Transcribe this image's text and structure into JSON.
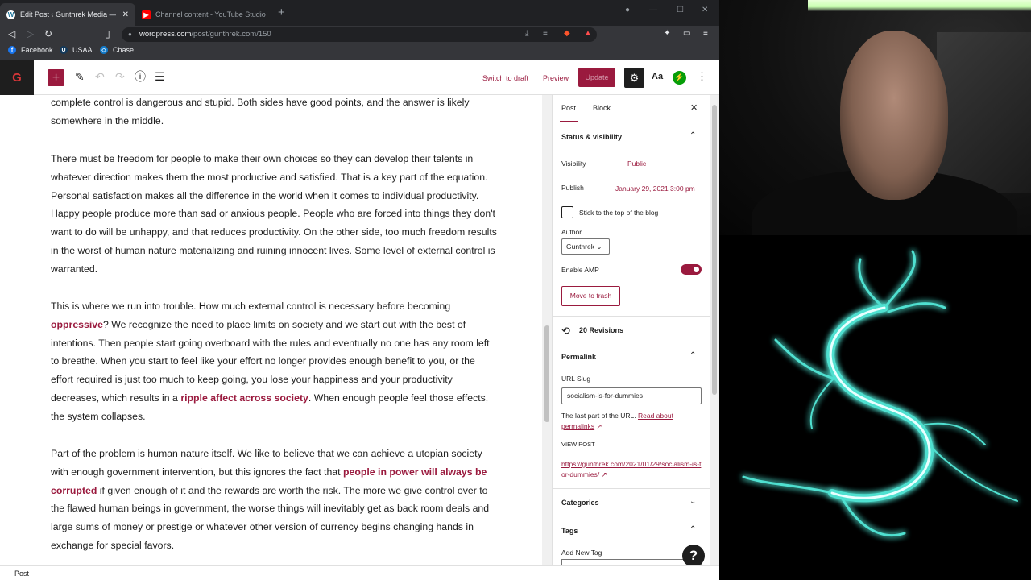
{
  "browser": {
    "tabs": [
      {
        "label": "Edit Post ‹ Gunthrek Media — W",
        "active": true,
        "icon": "wordpress-icon"
      },
      {
        "label": "Channel content - YouTube Studio",
        "active": false,
        "icon": "youtube-icon"
      }
    ],
    "url_host": "wordpress.com",
    "url_path": "/post/gunthrek.com/150",
    "bookmarks": [
      "Facebook",
      "USAA",
      "Chase"
    ]
  },
  "toolbar": {
    "switch_draft": "Switch to draft",
    "preview": "Preview",
    "update": "Update",
    "styles": "Aa"
  },
  "content": {
    "p1": "complete control is dangerous and stupid.  Both sides have good points, and the answer is likely somewhere in the middle.",
    "p2": "There must be freedom for people to make their own choices so they can develop their talents in whatever direction makes them the most productive and satisfied.  That is a key part of the equation.  Personal satisfaction makes all the difference in the world when it comes to individual productivity.  Happy people produce more than sad or anxious people.  People who are forced into things they don't want to do will be unhappy, and that reduces productivity.  On the other side, too much freedom results in the worst of human nature materializing and ruining innocent lives.  Some level of external control is warranted.",
    "p3a": "This is where we run into trouble.  How much external control is necessary before becoming ",
    "p3_link1": "oppressive",
    "p3b": "?  We recognize the need to place limits on society and we start out with the best of intentions.  Then people start going overboard with the rules and eventually no one has any room left to breathe.  When you start to feel like your effort no longer provides enough benefit to you, or the effort required is just too much to keep going, you lose your happiness and your productivity decreases, which results in a ",
    "p3_link2": "ripple affect across society",
    "p3c": ".  When enough people feel those effects, the system collapses.",
    "p4a": "Part of the problem is human nature itself.  We like to believe that we can achieve a utopian society with enough government intervention, but this ignores the fact that ",
    "p4_link": "people in power will always be corrupted",
    "p4b": " if given enough of it and the rewards are worth the risk.  The more we give control over to the flawed human beings in government, the worse things will inevitably get as back room deals and large sums of money or prestige or whatever other version of currency begins changing hands in exchange for special favors."
  },
  "sidebar": {
    "tab_post": "Post",
    "tab_block": "Block",
    "status_title": "Status & visibility",
    "visibility_label": "Visibility",
    "visibility_value": "Public",
    "publish_label": "Publish",
    "publish_value": "January 29, 2021 3:00 pm",
    "sticky_label": "Stick to the top of the blog",
    "author_label": "Author",
    "author_value": "Gunthrek",
    "amp_label": "Enable AMP",
    "amp_enabled": true,
    "trash_label": "Move to trash",
    "revisions": "20 Revisions",
    "permalink_title": "Permalink",
    "url_slug_label": "URL Slug",
    "url_slug_value": "socialism-is-for-dummies",
    "slug_help": "The last part of the URL.",
    "slug_help_link": "Read about permalinks",
    "view_post_label": "VIEW POST",
    "view_post_url": "https://gunthrek.com/2021/01/29/socialism-is-for-dummies/",
    "categories_title": "Categories",
    "tags_title": "Tags",
    "add_tag_label": "Add New Tag"
  },
  "footer": {
    "breadcrumb": "Post"
  },
  "colors": {
    "accent": "#9a1a3e",
    "jetpack": "#069e08",
    "art_glow": "#4fe0d0"
  }
}
